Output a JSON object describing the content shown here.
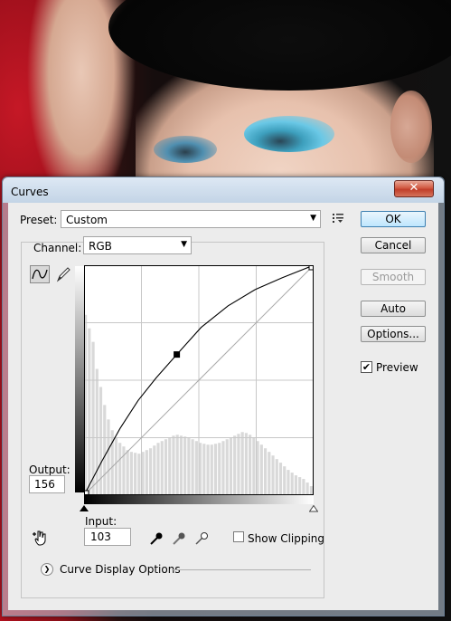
{
  "window": {
    "title": "Curves",
    "close_label": "✕"
  },
  "preset": {
    "label": "Preset:",
    "value": "Custom"
  },
  "channel": {
    "label": "Channel:",
    "value": "RGB"
  },
  "output": {
    "label": "Output:",
    "value": "156"
  },
  "input": {
    "label": "Input:",
    "value": "103"
  },
  "show_clipping": {
    "label": "Show Clipping",
    "checked": false
  },
  "curve_display_options": {
    "label": "Curve Display Options"
  },
  "buttons": {
    "ok": "OK",
    "cancel": "Cancel",
    "smooth": "Smooth",
    "auto": "Auto",
    "options": "Options..."
  },
  "preview": {
    "label": "Preview",
    "checked": true
  },
  "icons": {
    "preset_menu": "preset-options-icon",
    "curve_tool": "curve-tool-icon",
    "pencil_tool": "pencil-icon",
    "hand_tool": "targeted-adjustment-hand-icon",
    "black_eyedropper": "black-point-eyedropper-icon",
    "gray_eyedropper": "gray-point-eyedropper-icon",
    "white_eyedropper": "white-point-eyedropper-icon",
    "expand": "expand-chevron-icon"
  },
  "colors": {
    "ok_button_border": "#3c7fb1",
    "close_button": "#c13e2a",
    "graph_background": "#ffffff",
    "histogram": "#d9d9d9"
  },
  "curve": {
    "control_points": [
      [
        0,
        0
      ],
      [
        103,
        156
      ],
      [
        255,
        255
      ]
    ],
    "shape_points": [
      [
        0,
        0
      ],
      [
        20,
        38
      ],
      [
        40,
        74
      ],
      [
        60,
        105
      ],
      [
        80,
        130
      ],
      [
        103,
        156
      ],
      [
        130,
        186
      ],
      [
        160,
        210
      ],
      [
        190,
        228
      ],
      [
        220,
        241
      ],
      [
        255,
        255
      ]
    ],
    "range": [
      0,
      255
    ],
    "histogram": [
      200,
      185,
      170,
      140,
      120,
      100,
      84,
      72,
      64,
      58,
      54,
      50,
      48,
      47,
      46,
      48,
      50,
      52,
      55,
      58,
      60,
      62,
      64,
      66,
      67,
      66,
      65,
      64,
      62,
      60,
      58,
      57,
      56,
      56,
      57,
      58,
      60,
      62,
      64,
      66,
      68,
      70,
      69,
      67,
      64,
      60,
      56,
      52,
      48,
      44,
      40,
      36,
      32,
      28,
      25,
      22,
      20,
      18,
      14,
      10
    ]
  }
}
